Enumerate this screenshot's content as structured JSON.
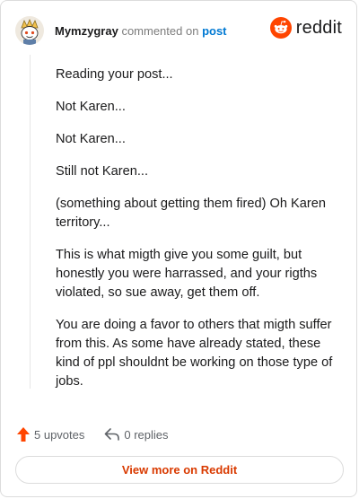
{
  "header": {
    "username": "Mymzygray",
    "commented_text": "commented on",
    "post_link": "post",
    "brand": "reddit"
  },
  "comment": {
    "paragraphs": [
      "Reading your post...",
      "Not Karen...",
      "Not Karen...",
      "Still not Karen...",
      "(something about getting them fired) Oh Karen territory...",
      "This is what migth give you some guilt, but honestly you were harrassed, and your rigths violated, so sue away, get them off.",
      "You are doing a favor to others that migth suffer from this. As some have already stated, these kind of ppl shouldnt be working on those type of jobs."
    ]
  },
  "actions": {
    "upvotes_label": "5 upvotes",
    "replies_label": "0 replies"
  },
  "footer": {
    "view_more_label": "View more on Reddit"
  },
  "colors": {
    "brand_orange": "#ff4500",
    "upvote_orange": "#ff4500",
    "link_blue": "#0079d3",
    "cta_text": "#d93a00"
  },
  "icons": {
    "avatar": "snoo-avatar",
    "brand": "reddit-snoo-icon",
    "upvote": "upvote-arrow-icon",
    "reply": "reply-arrow-icon"
  }
}
